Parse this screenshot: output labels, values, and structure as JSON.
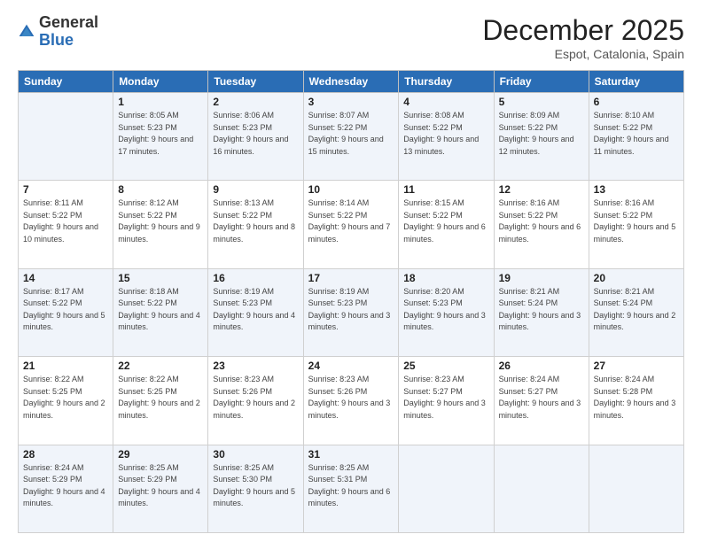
{
  "header": {
    "logo_general": "General",
    "logo_blue": "Blue",
    "month_title": "December 2025",
    "location": "Espot, Catalonia, Spain"
  },
  "days_of_week": [
    "Sunday",
    "Monday",
    "Tuesday",
    "Wednesday",
    "Thursday",
    "Friday",
    "Saturday"
  ],
  "weeks": [
    [
      {
        "day": "",
        "sunrise": "",
        "sunset": "",
        "daylight": ""
      },
      {
        "day": "1",
        "sunrise": "Sunrise: 8:05 AM",
        "sunset": "Sunset: 5:23 PM",
        "daylight": "Daylight: 9 hours and 17 minutes."
      },
      {
        "day": "2",
        "sunrise": "Sunrise: 8:06 AM",
        "sunset": "Sunset: 5:23 PM",
        "daylight": "Daylight: 9 hours and 16 minutes."
      },
      {
        "day": "3",
        "sunrise": "Sunrise: 8:07 AM",
        "sunset": "Sunset: 5:22 PM",
        "daylight": "Daylight: 9 hours and 15 minutes."
      },
      {
        "day": "4",
        "sunrise": "Sunrise: 8:08 AM",
        "sunset": "Sunset: 5:22 PM",
        "daylight": "Daylight: 9 hours and 13 minutes."
      },
      {
        "day": "5",
        "sunrise": "Sunrise: 8:09 AM",
        "sunset": "Sunset: 5:22 PM",
        "daylight": "Daylight: 9 hours and 12 minutes."
      },
      {
        "day": "6",
        "sunrise": "Sunrise: 8:10 AM",
        "sunset": "Sunset: 5:22 PM",
        "daylight": "Daylight: 9 hours and 11 minutes."
      }
    ],
    [
      {
        "day": "7",
        "sunrise": "Sunrise: 8:11 AM",
        "sunset": "Sunset: 5:22 PM",
        "daylight": "Daylight: 9 hours and 10 minutes."
      },
      {
        "day": "8",
        "sunrise": "Sunrise: 8:12 AM",
        "sunset": "Sunset: 5:22 PM",
        "daylight": "Daylight: 9 hours and 9 minutes."
      },
      {
        "day": "9",
        "sunrise": "Sunrise: 8:13 AM",
        "sunset": "Sunset: 5:22 PM",
        "daylight": "Daylight: 9 hours and 8 minutes."
      },
      {
        "day": "10",
        "sunrise": "Sunrise: 8:14 AM",
        "sunset": "Sunset: 5:22 PM",
        "daylight": "Daylight: 9 hours and 7 minutes."
      },
      {
        "day": "11",
        "sunrise": "Sunrise: 8:15 AM",
        "sunset": "Sunset: 5:22 PM",
        "daylight": "Daylight: 9 hours and 6 minutes."
      },
      {
        "day": "12",
        "sunrise": "Sunrise: 8:16 AM",
        "sunset": "Sunset: 5:22 PM",
        "daylight": "Daylight: 9 hours and 6 minutes."
      },
      {
        "day": "13",
        "sunrise": "Sunrise: 8:16 AM",
        "sunset": "Sunset: 5:22 PM",
        "daylight": "Daylight: 9 hours and 5 minutes."
      }
    ],
    [
      {
        "day": "14",
        "sunrise": "Sunrise: 8:17 AM",
        "sunset": "Sunset: 5:22 PM",
        "daylight": "Daylight: 9 hours and 5 minutes."
      },
      {
        "day": "15",
        "sunrise": "Sunrise: 8:18 AM",
        "sunset": "Sunset: 5:22 PM",
        "daylight": "Daylight: 9 hours and 4 minutes."
      },
      {
        "day": "16",
        "sunrise": "Sunrise: 8:19 AM",
        "sunset": "Sunset: 5:23 PM",
        "daylight": "Daylight: 9 hours and 4 minutes."
      },
      {
        "day": "17",
        "sunrise": "Sunrise: 8:19 AM",
        "sunset": "Sunset: 5:23 PM",
        "daylight": "Daylight: 9 hours and 3 minutes."
      },
      {
        "day": "18",
        "sunrise": "Sunrise: 8:20 AM",
        "sunset": "Sunset: 5:23 PM",
        "daylight": "Daylight: 9 hours and 3 minutes."
      },
      {
        "day": "19",
        "sunrise": "Sunrise: 8:21 AM",
        "sunset": "Sunset: 5:24 PM",
        "daylight": "Daylight: 9 hours and 3 minutes."
      },
      {
        "day": "20",
        "sunrise": "Sunrise: 8:21 AM",
        "sunset": "Sunset: 5:24 PM",
        "daylight": "Daylight: 9 hours and 2 minutes."
      }
    ],
    [
      {
        "day": "21",
        "sunrise": "Sunrise: 8:22 AM",
        "sunset": "Sunset: 5:25 PM",
        "daylight": "Daylight: 9 hours and 2 minutes."
      },
      {
        "day": "22",
        "sunrise": "Sunrise: 8:22 AM",
        "sunset": "Sunset: 5:25 PM",
        "daylight": "Daylight: 9 hours and 2 minutes."
      },
      {
        "day": "23",
        "sunrise": "Sunrise: 8:23 AM",
        "sunset": "Sunset: 5:26 PM",
        "daylight": "Daylight: 9 hours and 2 minutes."
      },
      {
        "day": "24",
        "sunrise": "Sunrise: 8:23 AM",
        "sunset": "Sunset: 5:26 PM",
        "daylight": "Daylight: 9 hours and 3 minutes."
      },
      {
        "day": "25",
        "sunrise": "Sunrise: 8:23 AM",
        "sunset": "Sunset: 5:27 PM",
        "daylight": "Daylight: 9 hours and 3 minutes."
      },
      {
        "day": "26",
        "sunrise": "Sunrise: 8:24 AM",
        "sunset": "Sunset: 5:27 PM",
        "daylight": "Daylight: 9 hours and 3 minutes."
      },
      {
        "day": "27",
        "sunrise": "Sunrise: 8:24 AM",
        "sunset": "Sunset: 5:28 PM",
        "daylight": "Daylight: 9 hours and 3 minutes."
      }
    ],
    [
      {
        "day": "28",
        "sunrise": "Sunrise: 8:24 AM",
        "sunset": "Sunset: 5:29 PM",
        "daylight": "Daylight: 9 hours and 4 minutes."
      },
      {
        "day": "29",
        "sunrise": "Sunrise: 8:25 AM",
        "sunset": "Sunset: 5:29 PM",
        "daylight": "Daylight: 9 hours and 4 minutes."
      },
      {
        "day": "30",
        "sunrise": "Sunrise: 8:25 AM",
        "sunset": "Sunset: 5:30 PM",
        "daylight": "Daylight: 9 hours and 5 minutes."
      },
      {
        "day": "31",
        "sunrise": "Sunrise: 8:25 AM",
        "sunset": "Sunset: 5:31 PM",
        "daylight": "Daylight: 9 hours and 6 minutes."
      },
      {
        "day": "",
        "sunrise": "",
        "sunset": "",
        "daylight": ""
      },
      {
        "day": "",
        "sunrise": "",
        "sunset": "",
        "daylight": ""
      },
      {
        "day": "",
        "sunrise": "",
        "sunset": "",
        "daylight": ""
      }
    ]
  ]
}
